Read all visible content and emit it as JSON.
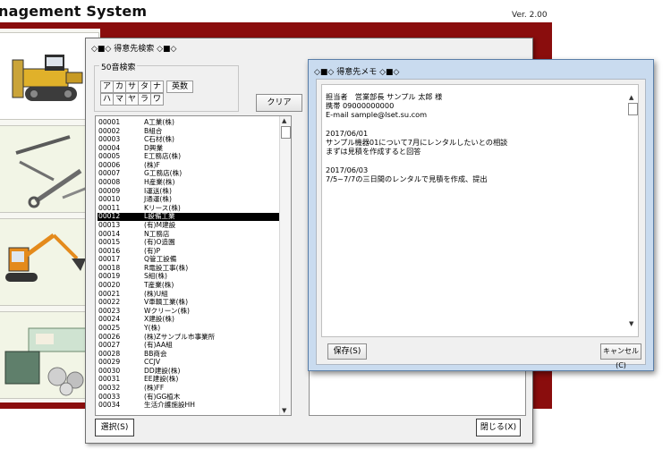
{
  "app": {
    "title": "nagement System",
    "version": "Ver. 2.00"
  },
  "search_dialog": {
    "title": "◇■◇ 得意先検索 ◇■◇",
    "kana_group_label": "50音検索",
    "kana_row1": [
      "ア",
      "カ",
      "サ",
      "タ",
      "ナ"
    ],
    "kana_row1_wide": "英数",
    "kana_row2": [
      "ハ",
      "マ",
      "ヤ",
      "ラ",
      "ワ"
    ],
    "clear_label": "クリア",
    "select_label": "選択(S)",
    "close_label": "閉じる(X)",
    "selected_code": "00012",
    "customers": [
      {
        "code": "00001",
        "name": "A工業(株)"
      },
      {
        "code": "00002",
        "name": "B組合"
      },
      {
        "code": "00003",
        "name": "C石材(株)"
      },
      {
        "code": "00004",
        "name": "D興業"
      },
      {
        "code": "00005",
        "name": "E工務店(株)"
      },
      {
        "code": "00006",
        "name": "(株)F"
      },
      {
        "code": "00007",
        "name": "G工務店(株)"
      },
      {
        "code": "00008",
        "name": "H産業(株)"
      },
      {
        "code": "00009",
        "name": "I運送(株)"
      },
      {
        "code": "00010",
        "name": "J通運(株)"
      },
      {
        "code": "00011",
        "name": "Kリース(株)"
      },
      {
        "code": "00012",
        "name": "L設備工業"
      },
      {
        "code": "00013",
        "name": "(有)M建設"
      },
      {
        "code": "00014",
        "name": "N工務店"
      },
      {
        "code": "00015",
        "name": "(有)O造園"
      },
      {
        "code": "00016",
        "name": "(有)P"
      },
      {
        "code": "00017",
        "name": "Q管工設備"
      },
      {
        "code": "00018",
        "name": "R電設工事(株)"
      },
      {
        "code": "00019",
        "name": "S組(株)"
      },
      {
        "code": "00020",
        "name": "T産業(株)"
      },
      {
        "code": "00021",
        "name": "(株)U組"
      },
      {
        "code": "00022",
        "name": "V車輌工業(株)"
      },
      {
        "code": "00023",
        "name": "Wクリーン(株)"
      },
      {
        "code": "00024",
        "name": "X建設(株)"
      },
      {
        "code": "00025",
        "name": "Y(株)"
      },
      {
        "code": "00026",
        "name": "(株)Zサンプル市事業所"
      },
      {
        "code": "00027",
        "name": "(有)AA組"
      },
      {
        "code": "00028",
        "name": "BB商会"
      },
      {
        "code": "00029",
        "name": "CCJV"
      },
      {
        "code": "00030",
        "name": "DD建設(株)"
      },
      {
        "code": "00031",
        "name": "EE建設(株)"
      },
      {
        "code": "00032",
        "name": "(株)FF"
      },
      {
        "code": "00033",
        "name": "(有)GG植木"
      },
      {
        "code": "00034",
        "name": "生活介護施設HH"
      }
    ]
  },
  "memo_dialog": {
    "title": "◇■◇ 得意先メモ ◇■◇",
    "lines": [
      "担当者　営業部長 サンプル 太郎 様",
      "携帯 09000000000",
      "E-mail sample@lset.su.com",
      "",
      "2017/06/01",
      "サンプル機器01について7月にレンタルしたいとの相談",
      "まずは見積を作成すると回答",
      "",
      "2017/06/03",
      "7/5~7/7の三日間のレンタルで見積を作成、提出"
    ],
    "save_label": "保存(S)",
    "cancel_label": "キャンセル(C)"
  },
  "menu_tiles": [
    "bulldozer-icon",
    "tools-icon",
    "excavator-icon",
    "money-icon"
  ],
  "colors": {
    "frame": "#8a0d0d",
    "selection": "#000000",
    "memo_border": "#c9dbef"
  }
}
